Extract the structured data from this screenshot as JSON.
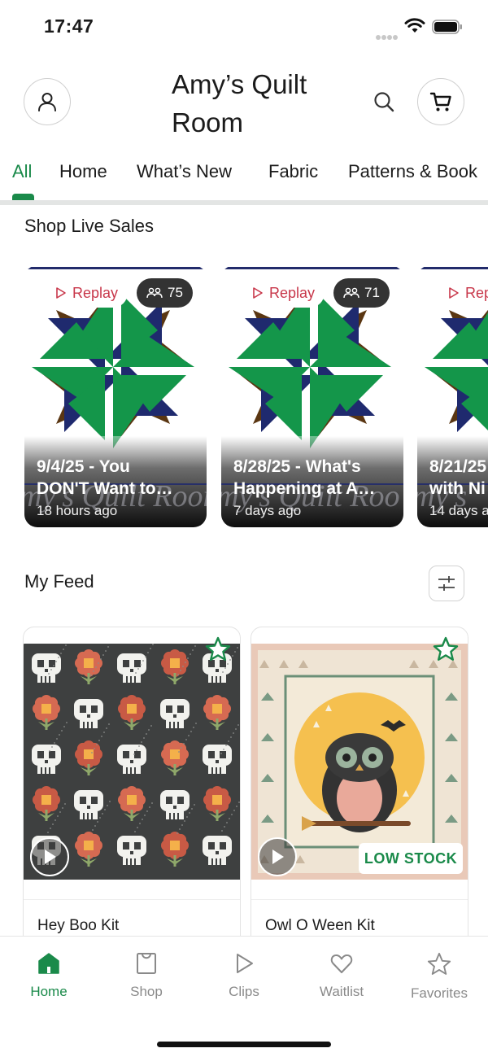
{
  "status_bar": {
    "time": "17:47"
  },
  "header": {
    "title": "Amy’s Quilt Room"
  },
  "tabs": [
    {
      "label": "All",
      "active": true
    },
    {
      "label": "Home"
    },
    {
      "label": "What’s New"
    },
    {
      "label": "Fabric"
    },
    {
      "label": "Patterns & Book"
    }
  ],
  "live_sales": {
    "title": "Shop Live Sales",
    "items": [
      {
        "badge": "Replay",
        "viewers": "75",
        "title_line1": "9/4/25 - You",
        "title_line2": "DON'T Want to…",
        "time": "18 hours ago",
        "watermark": "my's Quilt Room"
      },
      {
        "badge": "Replay",
        "viewers": "71",
        "title_line1": "8/28/25 - What's",
        "title_line2": "Happening at A…",
        "time": "7 days ago",
        "watermark": "my's Quilt Roo"
      },
      {
        "badge": "Rep",
        "viewers": "",
        "title_line1": "8/21/25",
        "title_line2": "with Ni",
        "time": "14 days a",
        "watermark": "my's"
      }
    ]
  },
  "feed": {
    "title": "My Feed",
    "items": [
      {
        "name": "Hey Boo Kit",
        "low_stock": false
      },
      {
        "name": "Owl O Ween Kit",
        "low_stock": true,
        "badge": "LOW STOCK"
      }
    ]
  },
  "bottom_nav": [
    {
      "label": "Home",
      "icon": "home-icon",
      "active": true
    },
    {
      "label": "Shop",
      "icon": "shop-bag-icon"
    },
    {
      "label": "Clips",
      "icon": "play-icon"
    },
    {
      "label": "Waitlist",
      "icon": "heart-icon"
    },
    {
      "label": "Favorites",
      "icon": "star-icon"
    }
  ],
  "colors": {
    "accent": "#1a8a4a",
    "replay": "#c8374a",
    "quilt_green": "#14964a",
    "quilt_navy": "#1f2a6e",
    "quilt_brown": "#5a3612"
  }
}
